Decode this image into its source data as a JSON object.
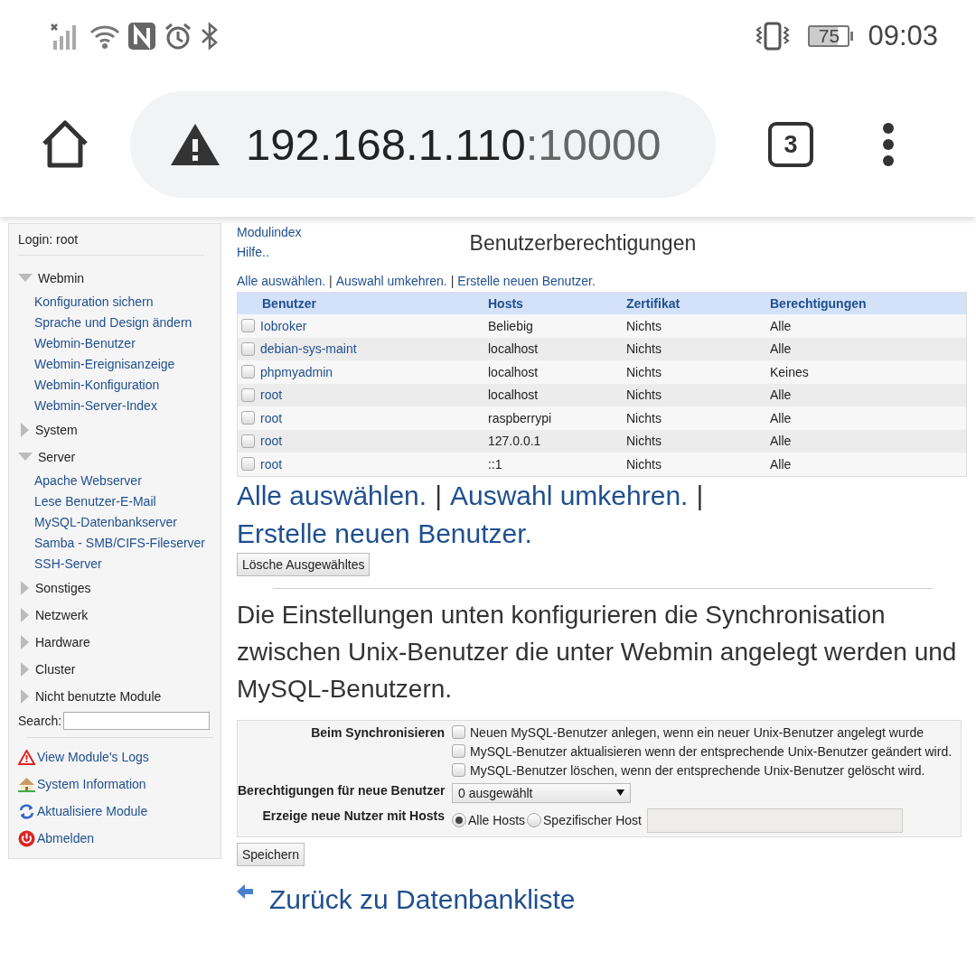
{
  "status_bar": {
    "battery": "75",
    "time": "09:03"
  },
  "browser": {
    "url_host": "192.168.1.110",
    "url_port": ":10000",
    "tab_count": "3"
  },
  "sidebar": {
    "login": "Login: root",
    "categories": [
      {
        "label": "Webmin",
        "expanded": true,
        "children": [
          {
            "label": "Konfiguration sichern"
          },
          {
            "label": "Sprache und Design ändern"
          },
          {
            "label": "Webmin-Benutzer"
          },
          {
            "label": "Webmin-Ereignisanzeige"
          },
          {
            "label": "Webmin-Konfiguration"
          },
          {
            "label": "Webmin-Server-Index"
          }
        ]
      },
      {
        "label": "System",
        "expanded": false
      },
      {
        "label": "Server",
        "expanded": true,
        "children": [
          {
            "label": "Apache Webserver"
          },
          {
            "label": "Lese Benutzer-E-Mail"
          },
          {
            "label": "MySQL-Datenbankserver"
          },
          {
            "label": "Samba - SMB/CIFS-Fileserver"
          },
          {
            "label": "SSH-Server"
          }
        ]
      },
      {
        "label": "Sonstiges",
        "expanded": false
      },
      {
        "label": "Netzwerk",
        "expanded": false
      },
      {
        "label": "Hardware",
        "expanded": false
      },
      {
        "label": "Cluster",
        "expanded": false
      },
      {
        "label": "Nicht benutzte Module",
        "expanded": false
      }
    ],
    "search": {
      "label": "Search:"
    },
    "links": [
      {
        "label": "View Module's Logs",
        "kind": "logs"
      },
      {
        "label": "System Information",
        "kind": "info"
      },
      {
        "label": "Aktualisiere Module",
        "kind": "refresh"
      },
      {
        "label": "Abmelden",
        "kind": "logout"
      }
    ]
  },
  "main": {
    "nav_links": [
      "Modulindex",
      "Hilfe.."
    ],
    "title": "Benutzerberechtigungen",
    "top_actions": {
      "separator": "|",
      "links": [
        "Alle auswählen.",
        "Auswahl umkehren.",
        "Erstelle neuen Benutzer."
      ]
    },
    "table": {
      "columns": [
        "Benutzer",
        "Hosts",
        "Zertifikat",
        "Berechtigungen"
      ],
      "rows": [
        {
          "checked": false,
          "cells": [
            "Iobroker",
            "Beliebig",
            "Nichts",
            "Alle"
          ]
        },
        {
          "checked": false,
          "cells": [
            "debian-sys-maint",
            "localhost",
            "Nichts",
            "Alle"
          ]
        },
        {
          "checked": false,
          "cells": [
            "phpmyadmin",
            "localhost",
            "Nichts",
            "Keines"
          ]
        },
        {
          "checked": false,
          "cells": [
            "root",
            "localhost",
            "Nichts",
            "Alle"
          ]
        },
        {
          "checked": false,
          "cells": [
            "root",
            "raspberrypi",
            "Nichts",
            "Alle"
          ]
        },
        {
          "checked": false,
          "cells": [
            "root",
            "127.0.0.1",
            "Nichts",
            "Alle"
          ]
        },
        {
          "checked": false,
          "cells": [
            "root",
            "::1",
            "Nichts",
            "Alle"
          ]
        }
      ]
    },
    "bottom_actions": {
      "separator": "|",
      "links": [
        "Alle auswählen.",
        "Auswahl umkehren.",
        "Erstelle neuen Benutzer."
      ]
    },
    "delete_button": "Lösche Ausgewähltes",
    "heading": "Die Einstellungen unten konfigurieren die Synchronisation zwischen Unix-Benutzer die unter Webmin angelegt werden und MySQL-Benutzern.",
    "sync_form": {
      "sync_label": "Beim Synchronisieren",
      "sync_options": [
        {
          "label": "Neuen MySQL-Benutzer anlegen, wenn ein neuer Unix-Benutzer angelegt wurde",
          "checked": false
        },
        {
          "label": "MySQL-Benutzer aktualisieren wenn der entsprechende Unix-Benutzer geändert wird.",
          "checked": false
        },
        {
          "label": "MySQL-Benutzer löschen, wenn der entsprechende Unix-Benutzer gelöscht wird.",
          "checked": false
        }
      ],
      "perm_label": "Berechtigungen für neue Benutzer",
      "perm_value": "0 ausgewählt",
      "hosts_label": "Erzeige neue Nutzer mit Hosts",
      "host_options": [
        {
          "label": "Alle Hosts",
          "selected": true
        },
        {
          "label": "Spezifischer Host",
          "selected": false
        }
      ]
    },
    "save_button": "Speichern",
    "back_link": "Zurück zu Datenbankliste"
  }
}
